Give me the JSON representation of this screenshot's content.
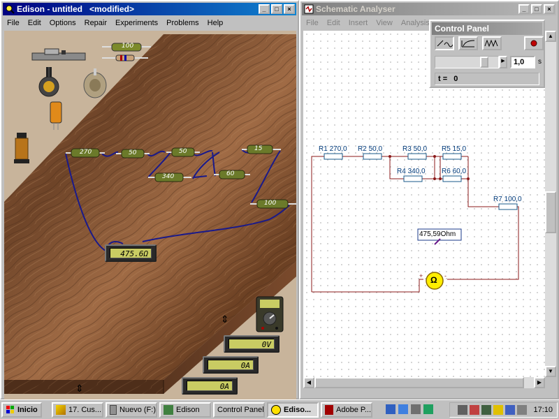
{
  "edison": {
    "title": "Edison - untitled   <modified>",
    "menu": [
      "File",
      "Edit",
      "Options",
      "Repair",
      "Experiments",
      "Problems",
      "Help"
    ],
    "bench_resistors": [
      "270",
      "50",
      "50",
      "15",
      "340",
      "60",
      "100"
    ],
    "toolbox_resistor": "100",
    "main_meter": "475.6Ω",
    "side_meters": [
      "0V",
      "0A",
      "0A"
    ]
  },
  "schematic": {
    "title": "Schematic Analyser",
    "menu": [
      "File",
      "Edit",
      "Insert",
      "View",
      "Analysis"
    ],
    "components": [
      {
        "name": "R1",
        "value": "270,0"
      },
      {
        "name": "R2",
        "value": "50,0"
      },
      {
        "name": "R3",
        "value": "50,0"
      },
      {
        "name": "R4",
        "value": "340,0"
      },
      {
        "name": "R5",
        "value": "15,0"
      },
      {
        "name": "R6",
        "value": "60,0"
      },
      {
        "name": "R7",
        "value": "100,0"
      }
    ],
    "meter_reading": "475,59Ohm",
    "meter_symbol": "Ω",
    "plus_sign": "+",
    "minus_sign": "-"
  },
  "control_panel": {
    "title": "Control Panel",
    "time_value": "1,0",
    "time_unit": "s",
    "t_label": "t =",
    "t_value": "0"
  },
  "taskbar": {
    "start": "Inicio",
    "tasks": [
      "17. Cus...",
      "Nuevo (F:)",
      "Edison",
      "Control Panel",
      "Ediso...",
      "Adobe P..."
    ],
    "clock": "17:10"
  },
  "colors": {
    "title_active": "#000080",
    "wire": "#1a1a8a",
    "schematic_wire": "#8b1a1a",
    "resistor_body": "#6b7a2a"
  }
}
